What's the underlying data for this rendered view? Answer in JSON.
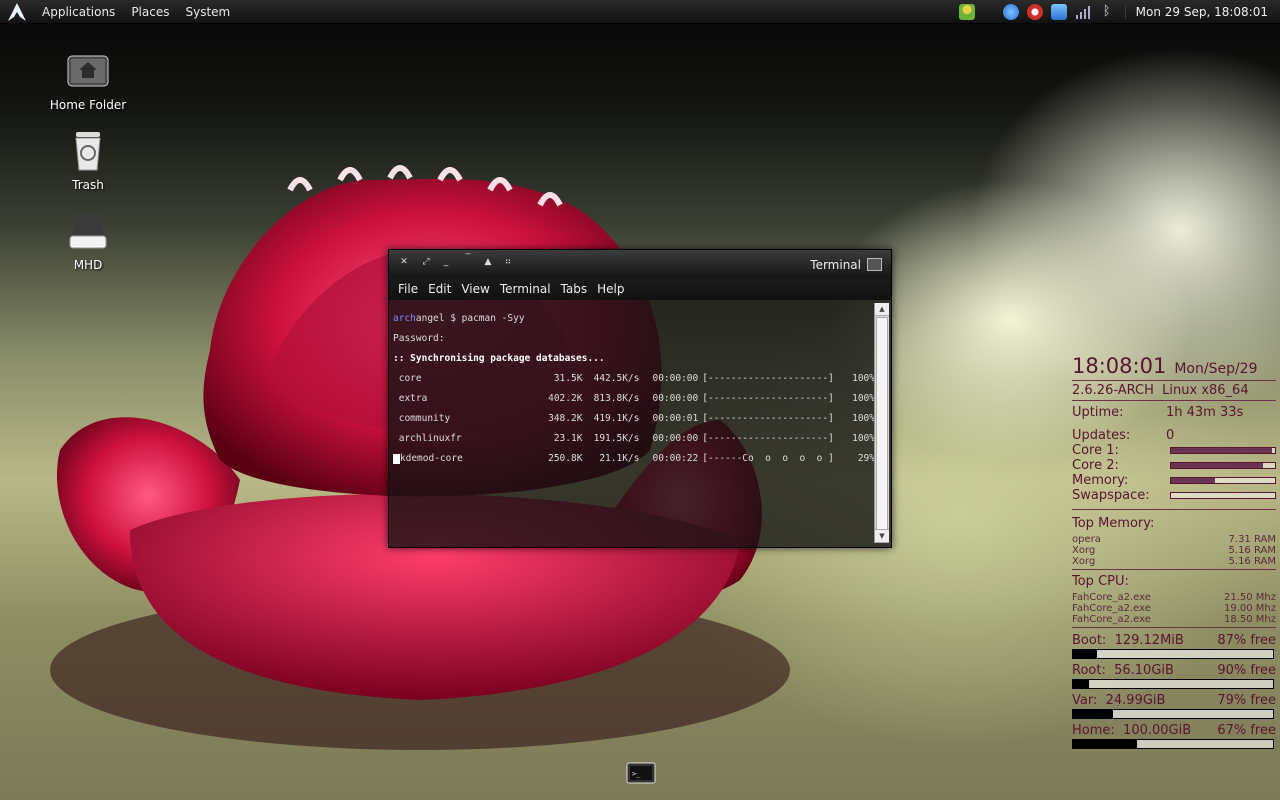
{
  "panel": {
    "menus": [
      "Applications",
      "Places",
      "System"
    ],
    "clock": "Mon 29 Sep, 18:08:01",
    "tray_icons": [
      "user-icon",
      "network-icon",
      "update-icon",
      "info-icon",
      "signal-icon",
      "bluetooth-icon"
    ]
  },
  "desktop": {
    "icons": [
      {
        "label": "Home Folder"
      },
      {
        "label": "Trash"
      },
      {
        "label": "MHD"
      }
    ]
  },
  "terminal": {
    "title": "Terminal",
    "menu": [
      "File",
      "Edit",
      "View",
      "Terminal",
      "Tabs",
      "Help"
    ],
    "prompt_host": "arch",
    "prompt_rest": "angel $ pacman -Syy",
    "password_line": "Password:",
    "sync_line": ":: Synchronising package databases...",
    "rows": [
      {
        "name": " core",
        "size": "31.5K",
        "rate": "442.5K/s",
        "time": "00:00:00",
        "bar": "[---------------------]",
        "pct": "100%"
      },
      {
        "name": " extra",
        "size": "402.2K",
        "rate": "813.8K/s",
        "time": "00:00:00",
        "bar": "[---------------------]",
        "pct": "100%"
      },
      {
        "name": " community",
        "size": "348.2K",
        "rate": "419.1K/s",
        "time": "00:00:01",
        "bar": "[---------------------]",
        "pct": "100%"
      },
      {
        "name": " archlinuxfr",
        "size": "23.1K",
        "rate": "191.5K/s",
        "time": "00:00:00",
        "bar": "[---------------------]",
        "pct": "100%"
      },
      {
        "name": "kdemod-core",
        "size": "250.8K",
        "rate": "21.1K/s",
        "time": "00:00:22",
        "bar": "[------Co  o  o  o  o ]",
        "pct": "29%"
      }
    ]
  },
  "conky": {
    "time": "18:08:01",
    "date": "Mon/Sep/29",
    "kernel": "2.6.26-ARCH",
    "os": "Linux x86_64",
    "uptime_label": "Uptime:",
    "uptime": "1h 43m 33s",
    "updates_label": "Updates:",
    "updates": "0",
    "meters": [
      {
        "label": "Core 1:",
        "value": 0.97
      },
      {
        "label": "Core 2:",
        "value": 0.88
      },
      {
        "label": "Memory:",
        "value": 0.42
      },
      {
        "label": "Swapspace:",
        "value": 0.0
      }
    ],
    "top_memory_label": "Top Memory:",
    "top_memory": [
      {
        "name": "opera",
        "value": "7.31 RAM"
      },
      {
        "name": "Xorg",
        "value": "5.16 RAM"
      },
      {
        "name": "Xorg",
        "value": "5.16 RAM"
      }
    ],
    "top_cpu_label": "Top CPU:",
    "top_cpu": [
      {
        "name": "FahCore_a2.exe",
        "value": "21.50 Mhz"
      },
      {
        "name": "FahCore_a2.exe",
        "value": "19.00 Mhz"
      },
      {
        "name": "FahCore_a2.exe",
        "value": "18.50 Mhz"
      }
    ],
    "disks": [
      {
        "label": "Boot:",
        "size": "129.12MiB",
        "free": "87% free",
        "used": 0.12
      },
      {
        "label": "Root:",
        "size": "56.10GiB",
        "free": "90% free",
        "used": 0.08
      },
      {
        "label": "Var:",
        "size": "24.99GiB",
        "free": "79% free",
        "used": 0.2
      },
      {
        "label": "Home:",
        "size": "100.00GiB",
        "free": "67% free",
        "used": 0.32
      }
    ]
  }
}
